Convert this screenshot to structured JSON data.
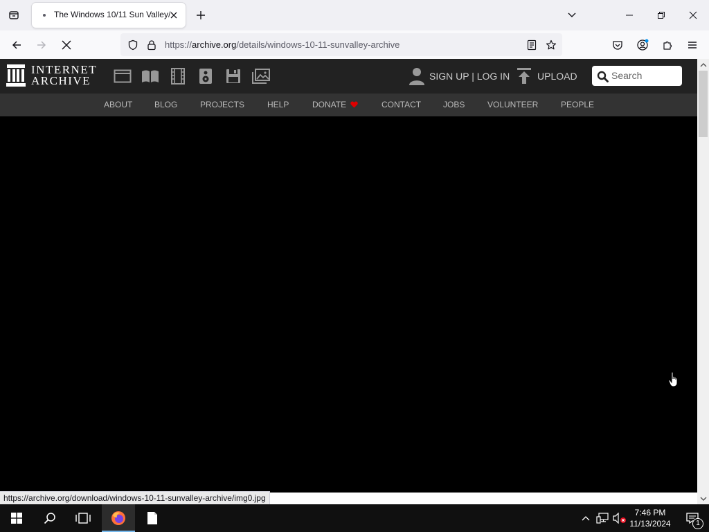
{
  "browser": {
    "tab": {
      "title": "The Windows 10/11 Sun Valley/"
    },
    "url": {
      "scheme": "https://",
      "host": "archive.org",
      "path": "/details/windows-10-11-sunvalley-archive"
    },
    "status_link": "https://archive.org/download/windows-10-11-sunvalley-archive/img0.jpg",
    "icons": [
      "list-all-tabs-icon",
      "close-icon",
      "plus-icon",
      "chevron-down-icon",
      "minimize-icon",
      "restore-icon",
      "back-arrow-icon",
      "forward-arrow-icon",
      "stop-loading-icon",
      "shield-icon",
      "lock-icon",
      "reader-view-icon",
      "star-icon",
      "pocket-icon",
      "account-icon",
      "extensions-icon",
      "hamburger-menu-icon"
    ]
  },
  "ia_header": {
    "logo": {
      "line1": "INTERNET",
      "line2": "ARCHIVE"
    },
    "media_icons": [
      "web-icon",
      "texts-icon",
      "video-icon",
      "audio-icon",
      "software-icon",
      "images-icon"
    ],
    "account": {
      "label": "SIGN UP | LOG IN"
    },
    "upload": {
      "label": "UPLOAD"
    },
    "search": {
      "placeholder": "Search"
    },
    "nav": [
      "ABOUT",
      "BLOG",
      "PROJECTS",
      "HELP",
      "DONATE",
      "CONTACT",
      "JOBS",
      "VOLUNTEER",
      "PEOPLE"
    ],
    "colors": {
      "header_bg": "#222222",
      "nav_bg": "#333333",
      "donate_heart": "#e00000"
    }
  },
  "content": {
    "background": "#000000"
  },
  "taskbar": {
    "clock": {
      "time": "7:46 PM",
      "date": "11/13/2024"
    },
    "notifications_count": "1",
    "icons": [
      "windows-start-icon",
      "search-icon",
      "task-view-icon",
      "firefox-icon",
      "file-icon",
      "chevron-up-icon",
      "network-icon",
      "volume-muted-icon",
      "notification-icon"
    ]
  }
}
